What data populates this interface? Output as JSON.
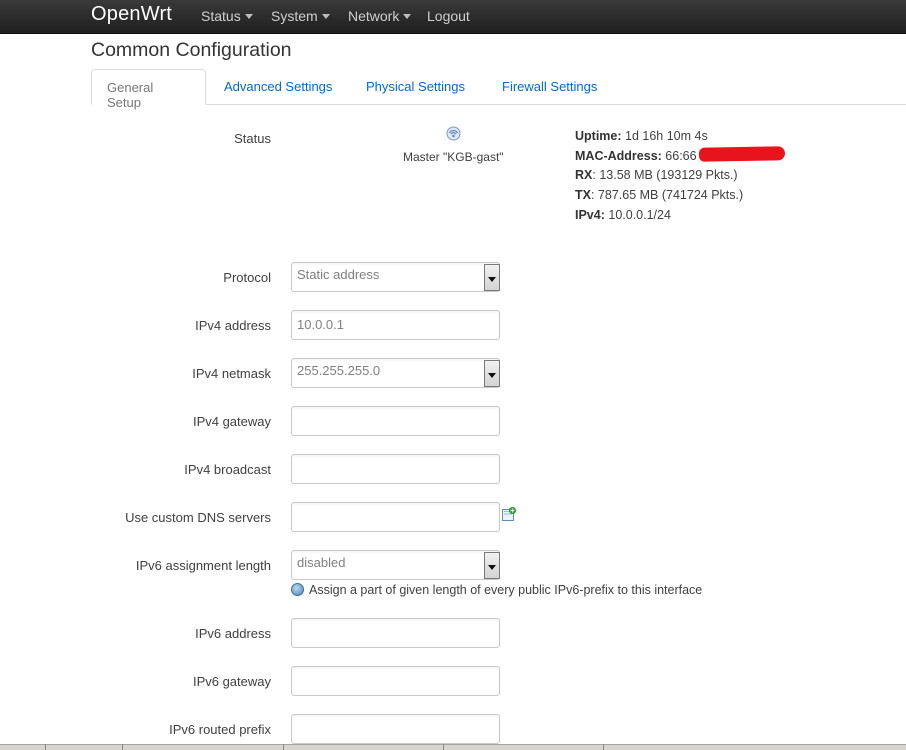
{
  "navbar": {
    "brand": "OpenWrt",
    "menu": [
      {
        "label": "Status",
        "dropdown": true
      },
      {
        "label": "System",
        "dropdown": true
      },
      {
        "label": "Network",
        "dropdown": true
      },
      {
        "label": "Logout",
        "dropdown": false
      }
    ]
  },
  "page_title": "Common Configuration",
  "tabs": [
    {
      "label": "General Setup",
      "active": true
    },
    {
      "label": "Advanced Settings",
      "active": false
    },
    {
      "label": "Physical Settings",
      "active": false
    },
    {
      "label": "Firewall Settings",
      "active": false
    }
  ],
  "status": {
    "label": "Status",
    "ssid_text": "Master \"KGB-gast\"",
    "uptime_key": "Uptime:",
    "uptime_val": "1d 16h 10m 4s",
    "mac_key": "MAC-Address:",
    "mac_val": "66:66",
    "rx_key": "RX",
    "rx_val": ": 13.58 MB (193129 Pkts.)",
    "tx_key": "TX",
    "tx_val": ": 787.65 MB (741724 Pkts.)",
    "ipv4_key": "IPv4:",
    "ipv4_val": "10.0.0.1/24"
  },
  "form": {
    "protocol": {
      "label": "Protocol",
      "value": "Static address"
    },
    "ipv4_address": {
      "label": "IPv4 address",
      "value": "10.0.0.1"
    },
    "ipv4_netmask": {
      "label": "IPv4 netmask",
      "value": "255.255.255.0"
    },
    "ipv4_gateway": {
      "label": "IPv4 gateway",
      "value": ""
    },
    "ipv4_broadcast": {
      "label": "IPv4 broadcast",
      "value": ""
    },
    "custom_dns": {
      "label": "Use custom DNS servers",
      "value": ""
    },
    "ipv6_assignment": {
      "label": "IPv6 assignment length",
      "value": "disabled",
      "help": "Assign a part of given length of every public IPv6-prefix to this interface"
    },
    "ipv6_address": {
      "label": "IPv6 address",
      "value": ""
    },
    "ipv6_gateway": {
      "label": "IPv6 gateway",
      "value": ""
    },
    "ipv6_routed_prefix": {
      "label": "IPv6 routed prefix",
      "value": ""
    }
  },
  "colors": {
    "navbar": "#222222",
    "link": "#0069d6",
    "redaction": "#e8141b"
  }
}
